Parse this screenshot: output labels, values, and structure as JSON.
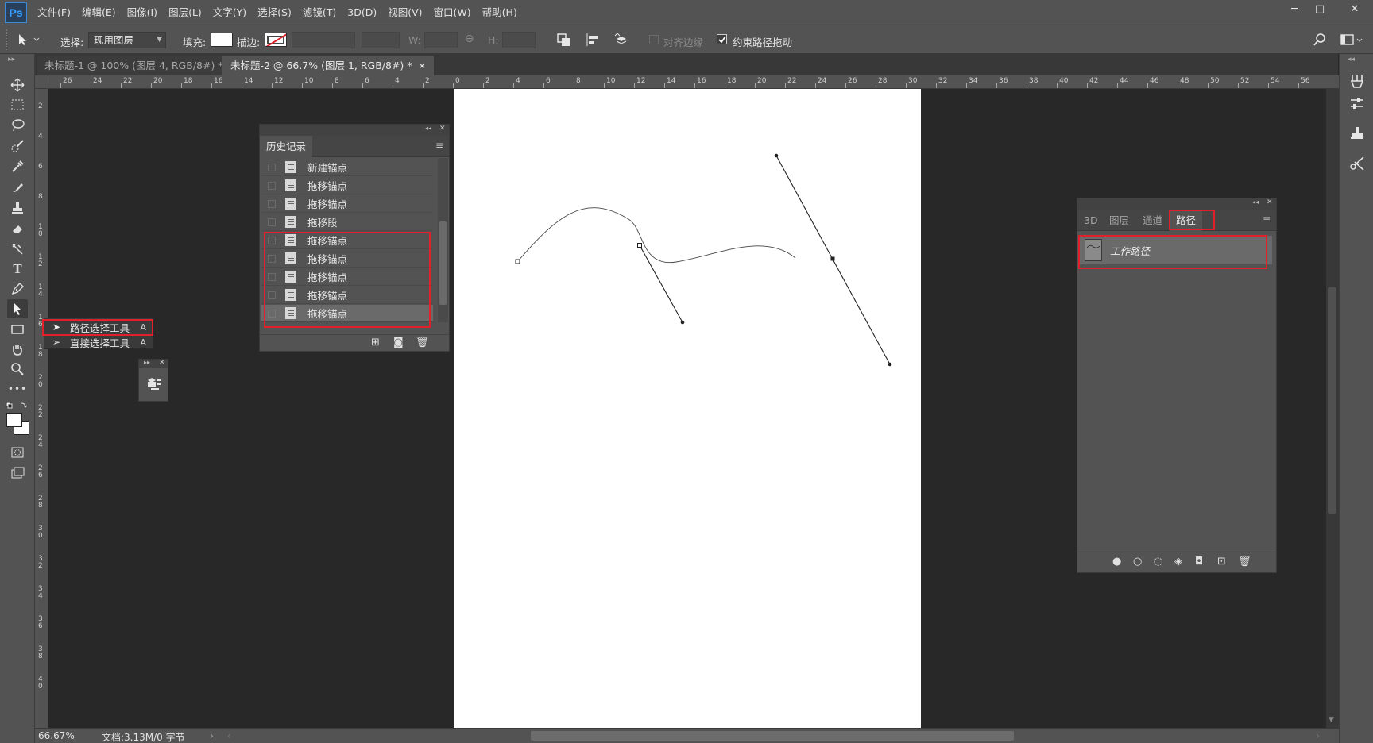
{
  "app": {
    "logo": "Ps"
  },
  "menubar": {
    "items": [
      "文件(F)",
      "编辑(E)",
      "图像(I)",
      "图层(L)",
      "文字(Y)",
      "选择(S)",
      "滤镜(T)",
      "3D(D)",
      "视图(V)",
      "窗口(W)",
      "帮助(H)"
    ]
  },
  "window_controls": {
    "minimize": "─",
    "maximize": "□",
    "close": "✕"
  },
  "options_bar": {
    "select_label": "选择:",
    "select_value": "现用图层",
    "fill_label": "填充:",
    "stroke_label": "描边:",
    "w_label": "W:",
    "h_label": "H:",
    "align_edges_label": "对齐边缘",
    "align_edges_checked": false,
    "constrain_label": "约束路径拖动",
    "constrain_checked": true
  },
  "doc_tabs": [
    {
      "label": "未标题-1 @ 100% (图层 4, RGB/8#) *",
      "active": false
    },
    {
      "label": "未标题-2 @ 66.7% (图层 1, RGB/8#) *",
      "active": true
    }
  ],
  "ruler_h": [
    "26",
    "24",
    "22",
    "20",
    "18",
    "16",
    "14",
    "12",
    "10",
    "8",
    "6",
    "4",
    "2",
    "0",
    "2",
    "4",
    "6",
    "8",
    "10",
    "12",
    "14",
    "16",
    "18",
    "20",
    "22",
    "24",
    "26",
    "28",
    "30",
    "32",
    "34",
    "36",
    "38",
    "40",
    "42",
    "44",
    "46",
    "48",
    "50",
    "52",
    "54",
    "56"
  ],
  "ruler_v": [
    "2",
    "4",
    "6",
    "8",
    "1 0",
    "1 2",
    "1 4",
    "1 6",
    "1 8",
    "2 0",
    "2 2",
    "2 4",
    "2 6",
    "2 8",
    "3 0",
    "3 2",
    "3 4",
    "3 6",
    "3 8",
    "4 0"
  ],
  "tool_flyout": {
    "items": [
      {
        "label": "路径选择工具",
        "key": "A"
      },
      {
        "label": "直接选择工具",
        "key": "A"
      }
    ]
  },
  "history_panel": {
    "tab": "历史记录",
    "items": [
      "新建锚点",
      "拖移锚点",
      "拖移锚点",
      "拖移段",
      "拖移锚点",
      "拖移锚点",
      "拖移锚点",
      "拖移锚点",
      "拖移锚点"
    ],
    "selected_index": 8
  },
  "paths_panel": {
    "tabs": [
      "3D",
      "图层",
      "通道",
      "路径"
    ],
    "active_tab": "路径",
    "items": [
      "工作路径"
    ]
  },
  "status": {
    "zoom": "66.67%",
    "doc_info": "文档:3.13M/0 字节"
  },
  "colors": {
    "highlight": "#e0202a",
    "panel_bg": "#535353",
    "workspace_bg": "#282828"
  }
}
